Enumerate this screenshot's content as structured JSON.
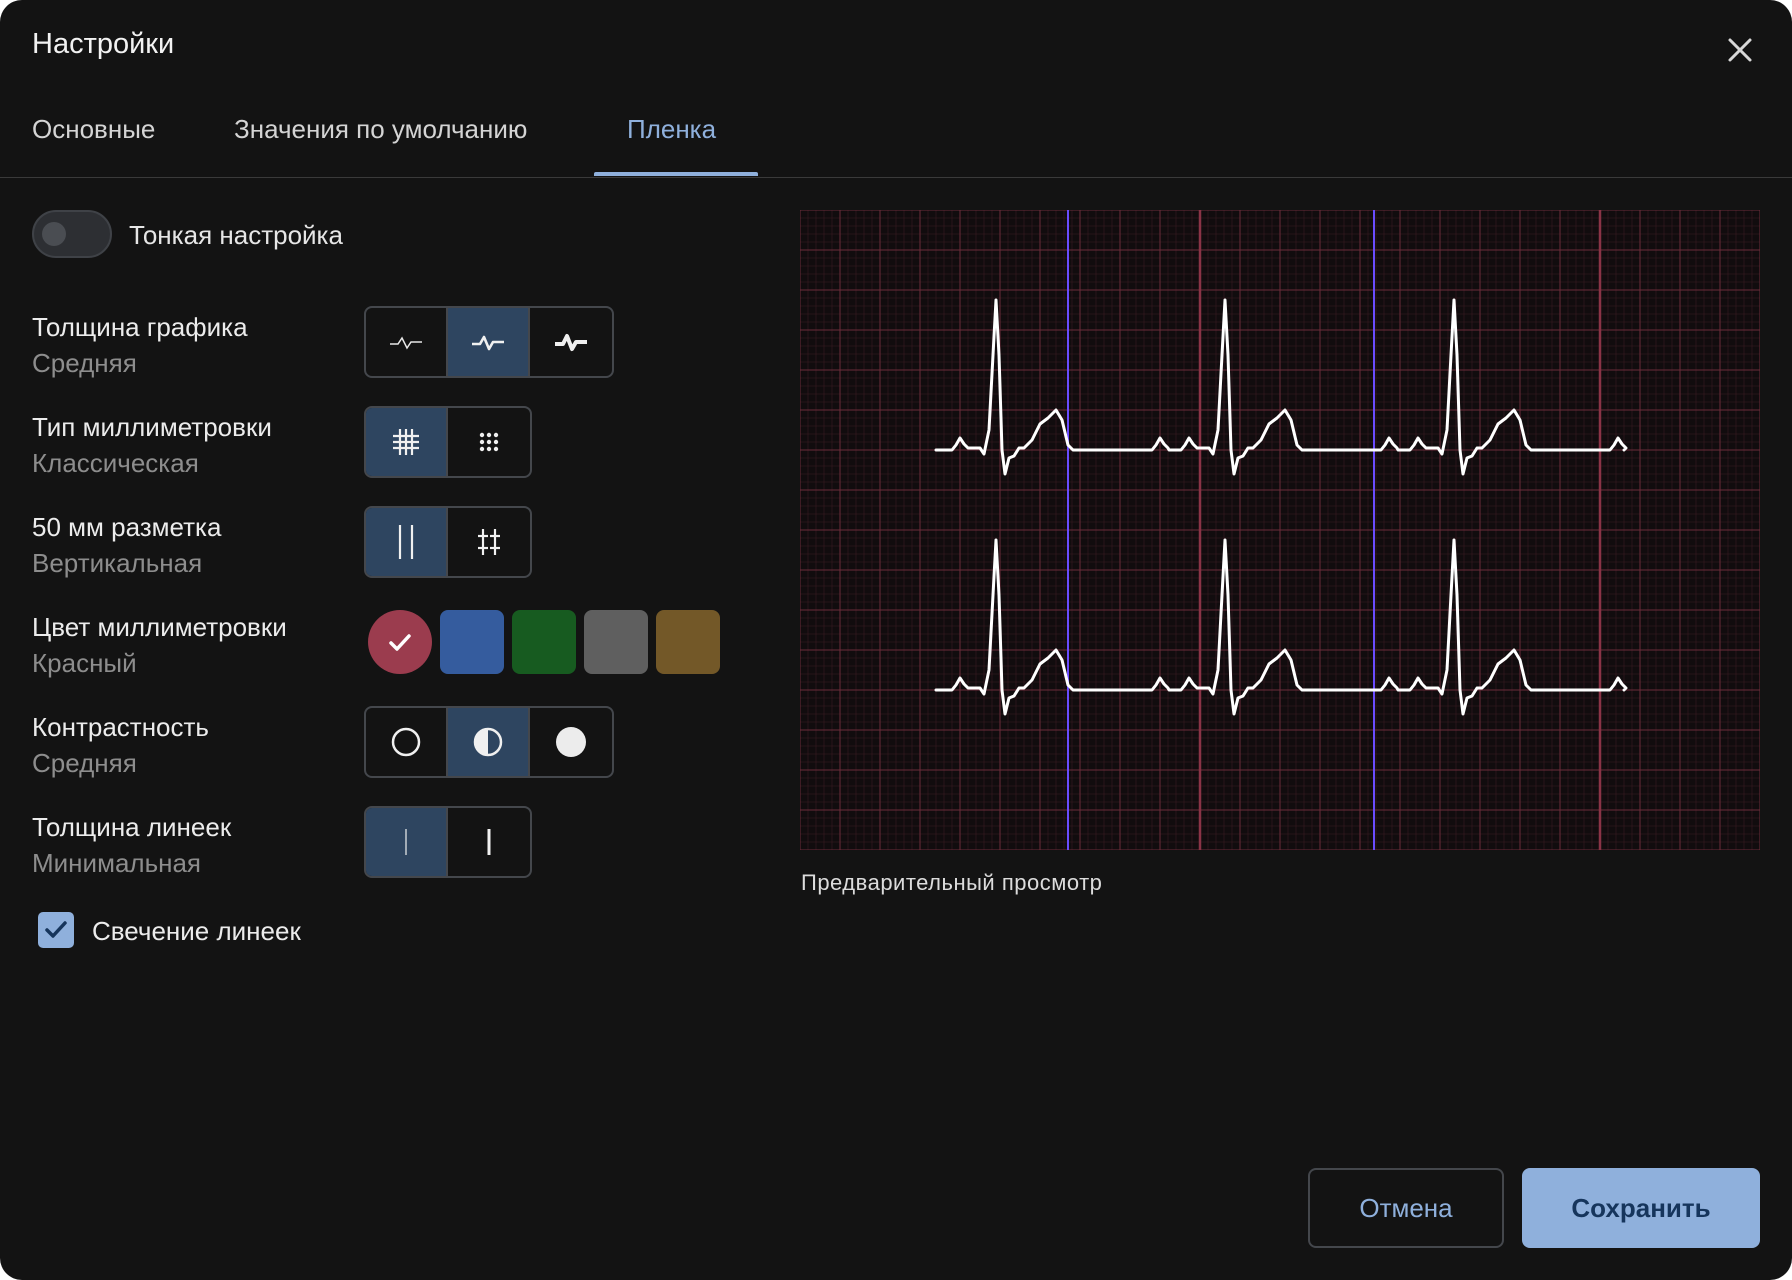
{
  "dialog": {
    "title": "Настройки",
    "close_icon": "close-icon"
  },
  "tabs": [
    {
      "label": "Основные",
      "active": false
    },
    {
      "label": "Значения по умолчанию",
      "active": false
    },
    {
      "label": "Пленка",
      "active": true
    }
  ],
  "fine_tune": {
    "label": "Тонкая настройка",
    "enabled": false
  },
  "settings": {
    "line_thickness": {
      "label": "Толщина графика",
      "value": "Средняя",
      "options": [
        "thin-wave-icon",
        "medium-wave-icon",
        "thick-wave-icon"
      ],
      "selected_index": 1
    },
    "grid_type": {
      "label": "Тип миллиметровки",
      "value": "Классическая",
      "options": [
        "grid-lines-icon",
        "grid-dots-icon"
      ],
      "selected_index": 0
    },
    "marking_50mm": {
      "label": "50 мм разметка",
      "value": "Вертикальная",
      "options": [
        "vertical-lines-icon",
        "crosses-icon"
      ],
      "selected_index": 0
    },
    "grid_color": {
      "label": "Цвет миллиметровки",
      "value": "Красный",
      "swatches": [
        "#9b3c4e",
        "#355c9e",
        "#175b20",
        "#5f5f5f",
        "#735828"
      ],
      "selected_index": 0
    },
    "contrast": {
      "label": "Контрастность",
      "value": "Средняя",
      "options": [
        "circle-outline-icon",
        "circle-half-icon",
        "circle-filled-icon"
      ],
      "selected_index": 1
    },
    "ruler_thickness": {
      "label": "Толщина линеек",
      "value": "Минимальная",
      "options": [
        "thin-line-icon",
        "thick-line-icon"
      ],
      "selected_index": 0
    }
  },
  "ruler_glow": {
    "label": "Свечение линеек",
    "checked": true
  },
  "preview": {
    "caption": "Предварительный просмотр"
  },
  "buttons": {
    "cancel": "Отмена",
    "save": "Сохранить"
  },
  "colors": {
    "accent": "#8fb0dc",
    "background": "#131313",
    "selected_segment": "#2e4560",
    "grid_minor": "#3a1c22",
    "grid_major": "#6b2d3a",
    "ruler": "#6a4cff"
  }
}
